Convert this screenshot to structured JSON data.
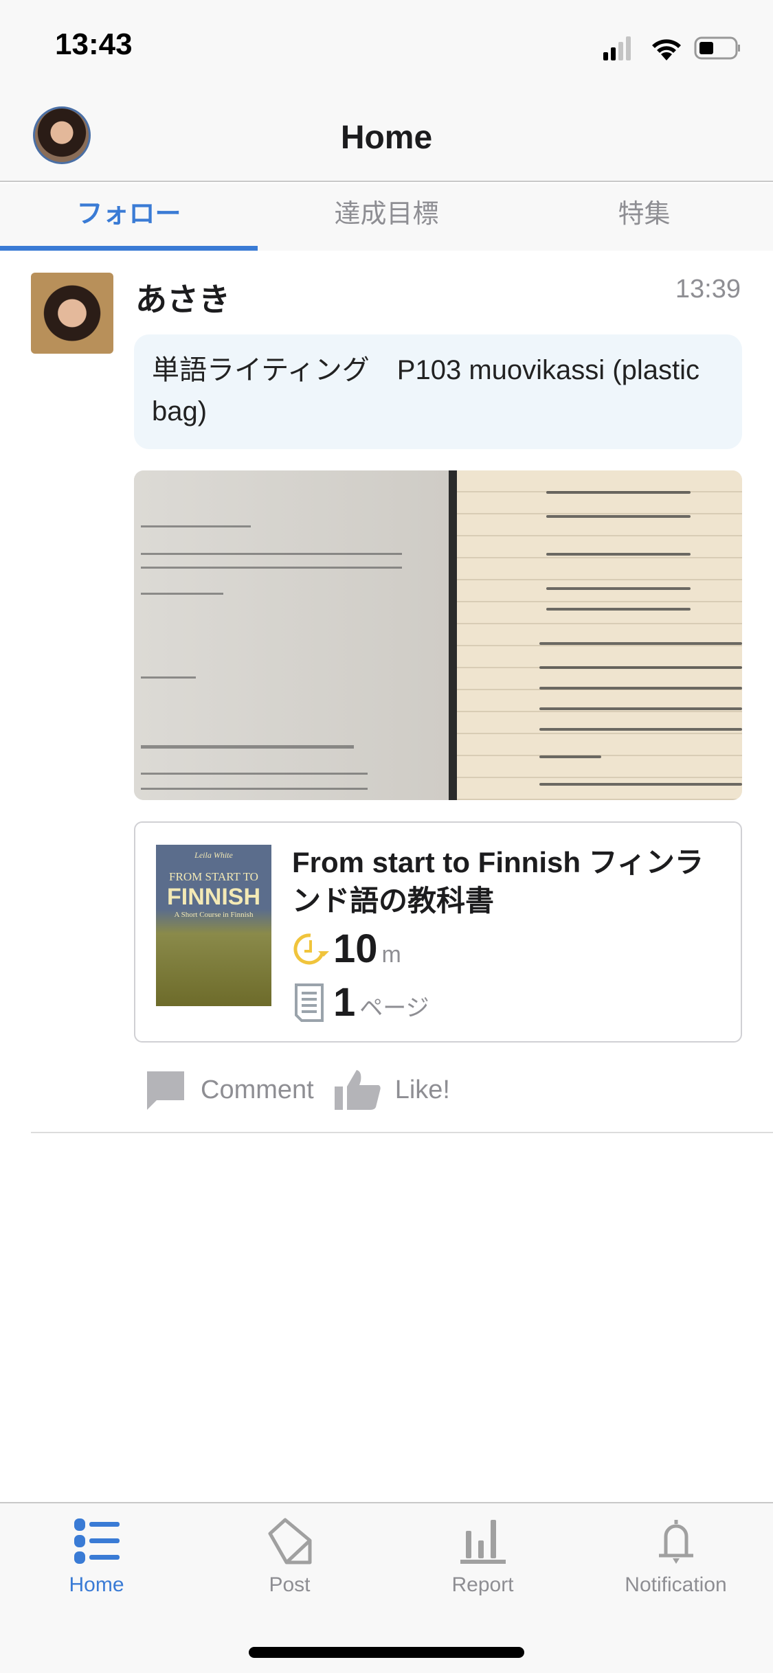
{
  "status_bar": {
    "time": "13:43",
    "icons": [
      "signal-icon",
      "wifi-icon",
      "battery-icon"
    ]
  },
  "header": {
    "title": "Home"
  },
  "tabs": [
    {
      "label": "フォロー",
      "active": true
    },
    {
      "label": "達成目標",
      "active": false
    },
    {
      "label": "特集",
      "active": false
    }
  ],
  "post": {
    "user_name": "あさき",
    "time": "13:39",
    "message": "単語ライティング　P103 muovikassi (plastic bag)",
    "book": {
      "title": "From start to Finnish フィンランド語の教科書",
      "cover_author": "Leila White",
      "cover_line1": "FROM START TO",
      "cover_line2": "FINNISH",
      "cover_line3": "A Short Course in Finnish",
      "duration_value": "10",
      "duration_unit": "m",
      "pages_value": "1",
      "pages_unit": "ページ"
    },
    "comment_label": "Comment",
    "like_label": "Like!"
  },
  "colors": {
    "accent": "#3a7bd5",
    "inactive": "#8e8e93",
    "timer": "#f0c43c",
    "bubble": "#eff6fb"
  },
  "nav": [
    {
      "label": "Home",
      "icon": "list-icon",
      "active": true
    },
    {
      "label": "Post",
      "icon": "pencil-icon",
      "active": false
    },
    {
      "label": "Report",
      "icon": "bar-chart-icon",
      "active": false
    },
    {
      "label": "Notification",
      "icon": "bell-icon",
      "active": false
    }
  ]
}
